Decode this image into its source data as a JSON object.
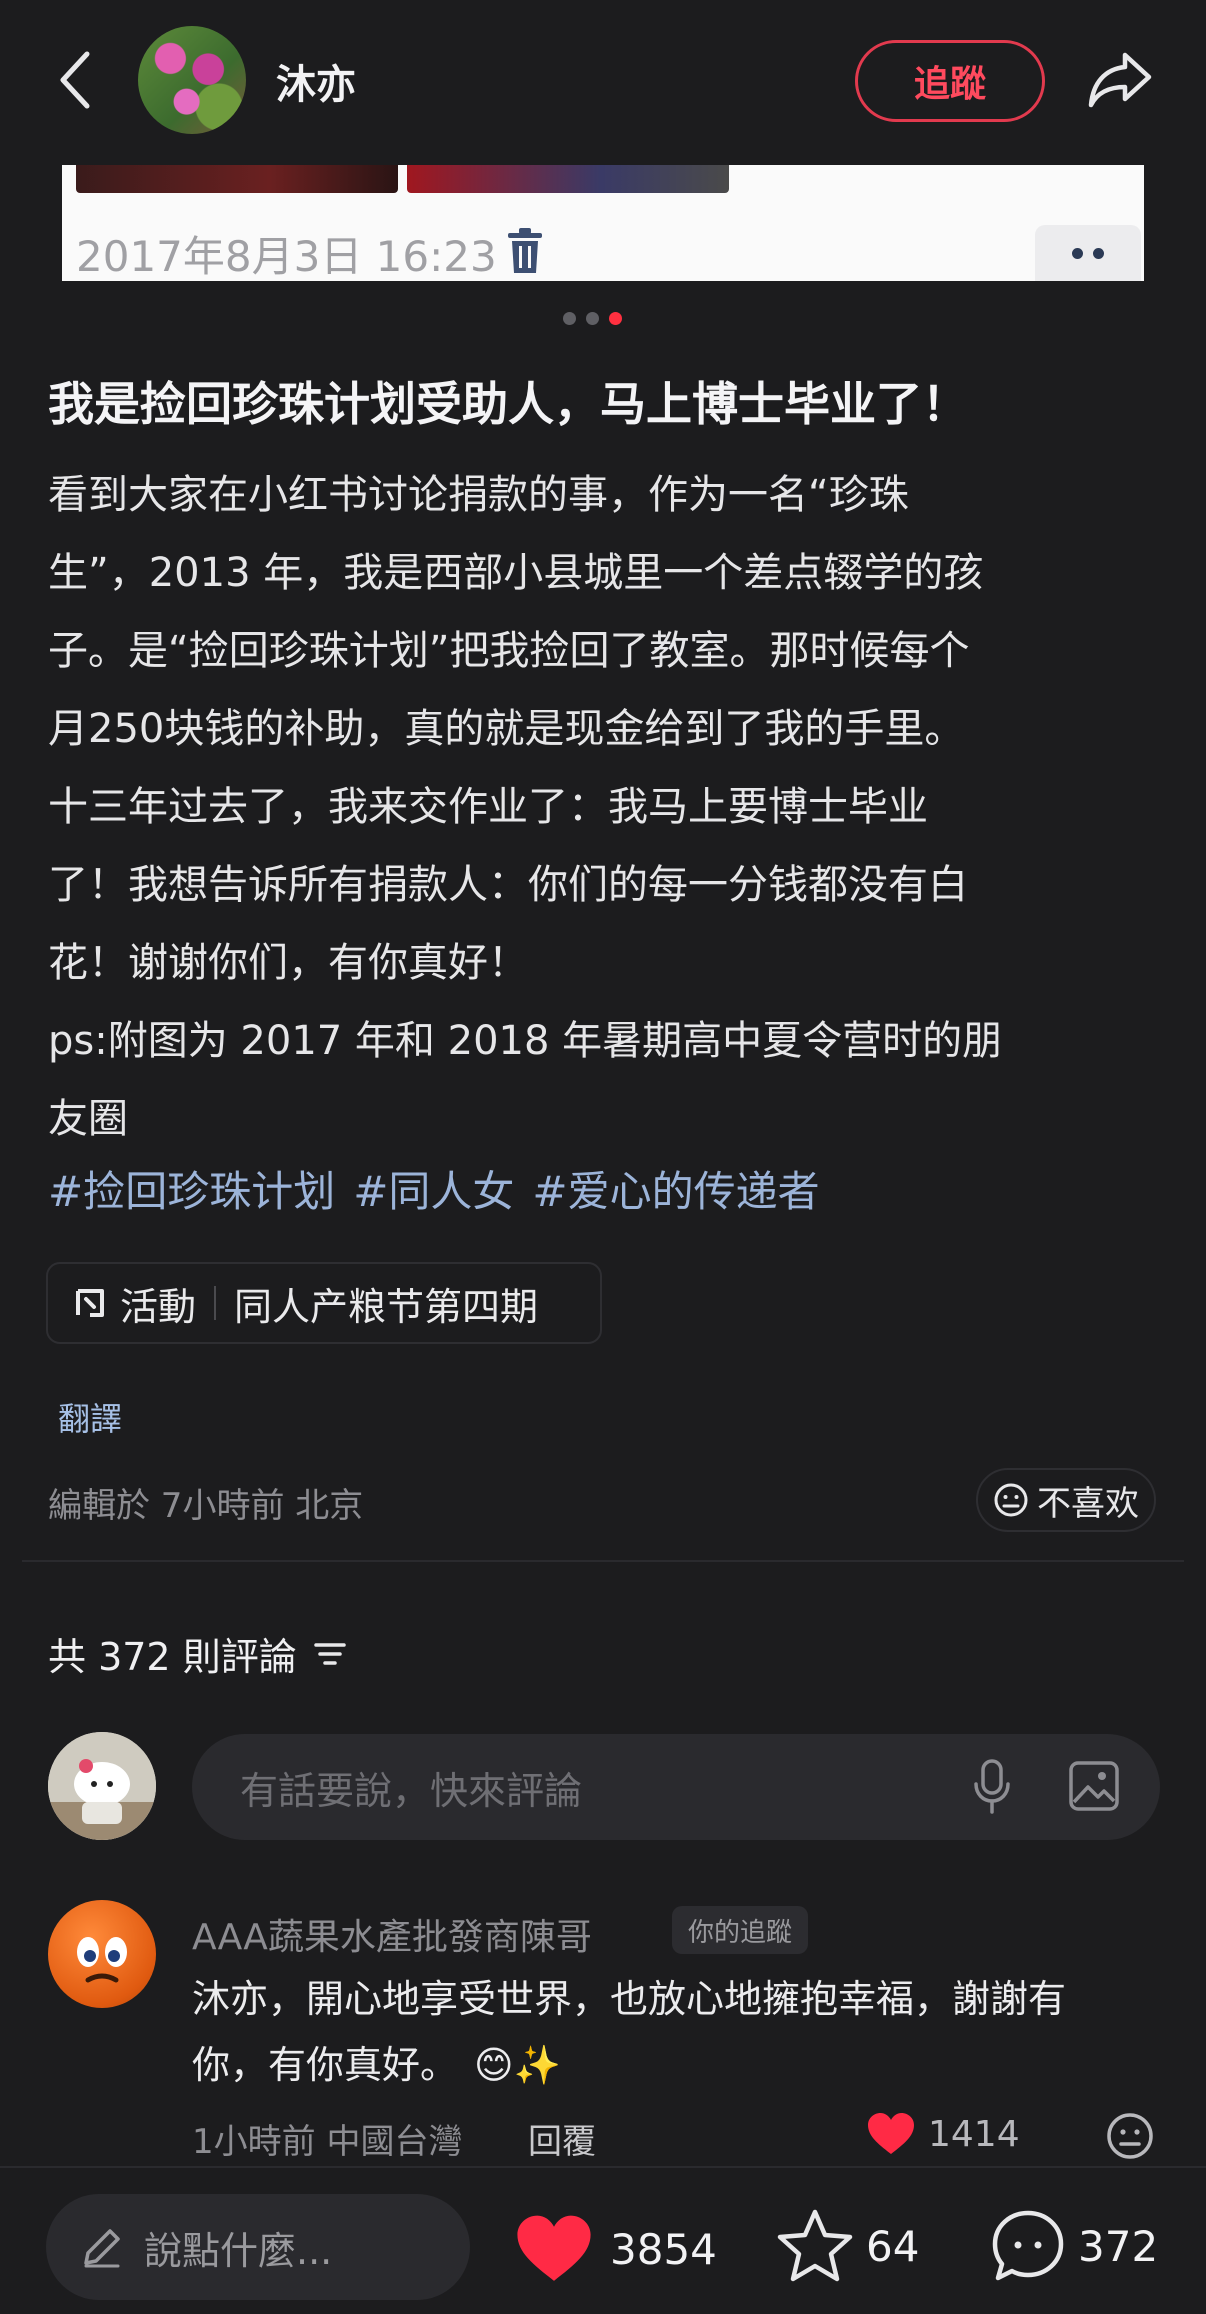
{
  "header": {
    "author_name": "沐亦",
    "follow_label": "追蹤"
  },
  "image": {
    "date_text": "2017年8月3日 16:23"
  },
  "post": {
    "title": "我是捡回珍珠计划受助人，马上博士毕业了！",
    "body_lines": [
      "看到大家在小红书讨论捐款的事，作为一名“珍珠",
      "生”，2013 年，我是西部小县城里一个差点辍学的孩",
      "子。是“捡回珍珠计划”把我捡回了教室。那时候每个",
      "月250块钱的补助，真的就是现金给到了我的手里。",
      "十三年过去了，我来交作业了：我马上要博士毕业",
      "了！我想告诉所有捐款人：你们的每一分钱都没有白",
      "花！谢谢你们，有你真好！",
      "ps:附图为 2017 年和 2018 年暑期高中夏令营时的朋",
      "友圈"
    ],
    "tags": [
      "#捡回珍珠计划",
      "#同人女",
      "#爱心的传递者"
    ],
    "activity_label": "活動",
    "activity_name": "同人产粮节第四期",
    "translate_label": "翻譯",
    "edit_meta": "編輯於 7小時前 北京",
    "dislike_label": "不喜欢"
  },
  "comments": {
    "count_label": "共 372 則評論",
    "input_placeholder": "有話要說，快來評論",
    "items": [
      {
        "name": "AAA蔬果水產批發商陳哥",
        "badge": "你的追蹤",
        "line1": "沐亦，開心地享受世界，也放心地擁抱幸福，謝謝有",
        "line2": "你，有你真好。",
        "emoji": "😊✨",
        "meta": "1小時前 中國台灣",
        "reply_label": "回覆",
        "likes": "1414"
      }
    ]
  },
  "bottom_bar": {
    "say_placeholder": "說點什麼...",
    "likes": "3854",
    "favorites": "64",
    "comments": "372"
  },
  "colors": {
    "accent": "#ff3040",
    "tag": "#9cb4d9",
    "background": "#1c1c1e"
  }
}
